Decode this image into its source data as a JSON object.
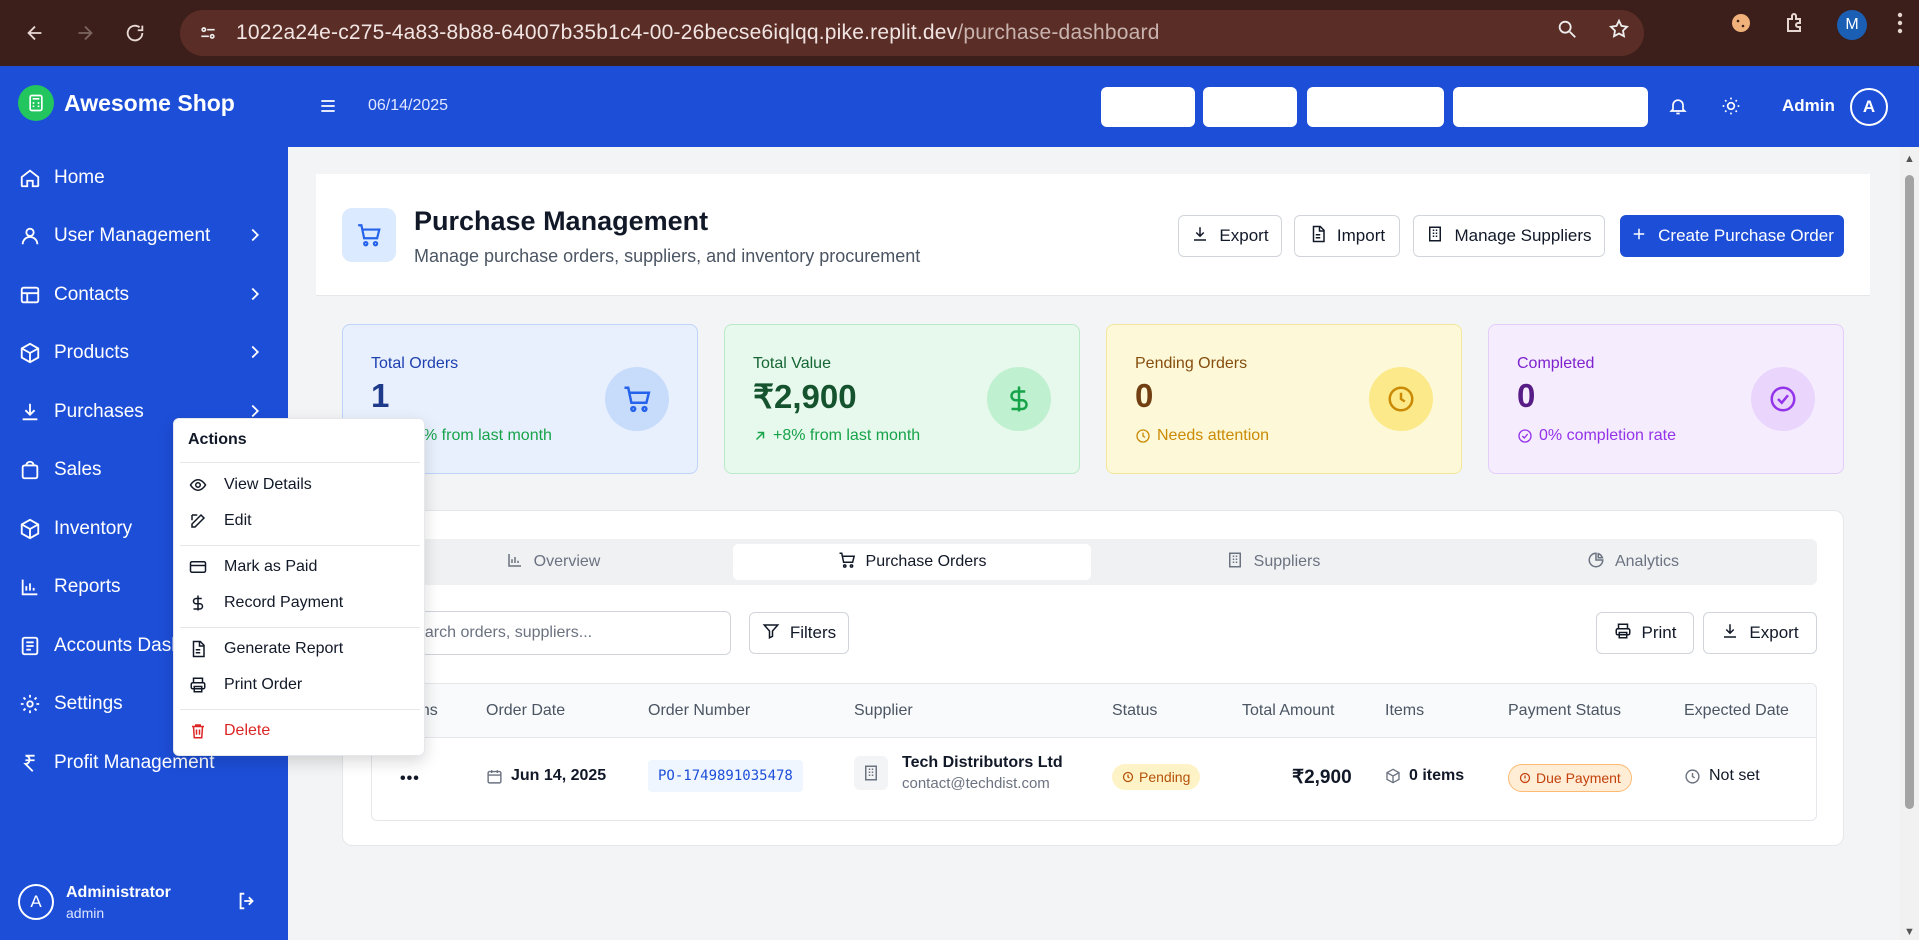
{
  "browser": {
    "url_host": "1022a24e-c275-4a83-8b88-64007b35b1c4-00-26becse6iqlqq.pike.replit.dev",
    "url_path": "/purchase-dashboard",
    "profile_initial": "M"
  },
  "sidebar": {
    "brand": "Awesome Shop",
    "items": [
      {
        "label": "Home",
        "icon": "home-icon",
        "has_children": false
      },
      {
        "label": "User Management",
        "icon": "user-icon",
        "has_children": true
      },
      {
        "label": "Contacts",
        "icon": "contacts-icon",
        "has_children": true
      },
      {
        "label": "Products",
        "icon": "box-icon",
        "has_children": true
      },
      {
        "label": "Purchases",
        "icon": "download-icon",
        "has_children": true
      },
      {
        "label": "Sales",
        "icon": "bag-icon",
        "has_children": false
      },
      {
        "label": "Inventory",
        "icon": "box-icon",
        "has_children": false
      },
      {
        "label": "Reports",
        "icon": "bar-chart-icon",
        "has_children": false
      },
      {
        "label": "Accounts Dash",
        "icon": "receipt-icon",
        "has_children": false
      },
      {
        "label": "Settings",
        "icon": "gear-icon",
        "has_children": false
      },
      {
        "label": "Profit Management",
        "icon": "rupee-icon",
        "has_children": false
      }
    ],
    "user": {
      "initial": "A",
      "name": "Administrator",
      "role": "admin"
    }
  },
  "topbar": {
    "date": "06/14/2025",
    "admin_label": "Admin",
    "admin_initial": "A"
  },
  "header": {
    "title": "Purchase Management",
    "subtitle": "Manage purchase orders, suppliers, and inventory procurement",
    "buttons": {
      "export": "Export",
      "import": "Import",
      "manage_suppliers": "Manage Suppliers",
      "create": "Create Purchase Order"
    }
  },
  "stats": [
    {
      "label": "Total Orders",
      "value": "1",
      "foot": "% from last month",
      "color": "#2563eb"
    },
    {
      "label": "Total Value",
      "value": "₹2,900",
      "foot": "+8% from last month",
      "color": "#16a34a"
    },
    {
      "label": "Pending Orders",
      "value": "0",
      "foot": "Needs attention",
      "color": "#ca8a04"
    },
    {
      "label": "Completed",
      "value": "0",
      "foot": "0% completion rate",
      "color": "#9333ea"
    }
  ],
  "tabs": [
    {
      "label": "Overview",
      "active": false
    },
    {
      "label": "Purchase Orders",
      "active": true
    },
    {
      "label": "Suppliers",
      "active": false
    },
    {
      "label": "Analytics",
      "active": false
    }
  ],
  "toolbar": {
    "search_placeholder": "earch orders, suppliers...",
    "filters": "Filters",
    "print": "Print",
    "export": "Export"
  },
  "table": {
    "columns": [
      "ons",
      "Order Date",
      "Order Number",
      "Supplier",
      "Status",
      "Total Amount",
      "Items",
      "Payment Status",
      "Expected Date"
    ],
    "rows": [
      {
        "actions": "•••",
        "order_date": "Jun 14, 2025",
        "order_number": "PO-1749891035478",
        "supplier_name": "Tech Distributors Ltd",
        "supplier_email": "contact@techdist.com",
        "status": "Pending",
        "total": "₹2,900",
        "items": "0 items",
        "payment_status": "Due Payment",
        "expected_date": "Not set"
      }
    ]
  },
  "actions_menu": {
    "title": "Actions",
    "items": {
      "view": "View Details",
      "edit": "Edit",
      "mark_paid": "Mark as Paid",
      "record_payment": "Record Payment",
      "generate_report": "Generate Report",
      "print_order": "Print Order",
      "delete": "Delete"
    }
  }
}
